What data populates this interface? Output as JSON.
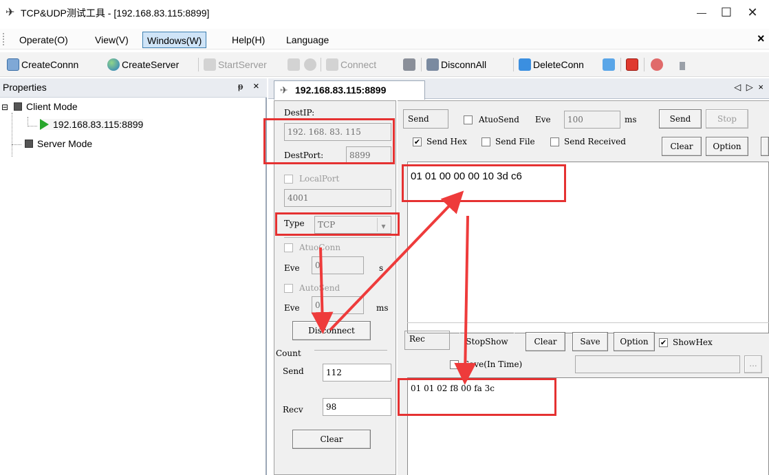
{
  "window": {
    "title": "TCP&UDP测试工具 - [192.168.83.115:8899]",
    "minimize": "—",
    "maximize": "☐",
    "close": "✕"
  },
  "menu": {
    "items": [
      "Operate(O)",
      "View(V)",
      "Windows(W)",
      "Help(H)",
      "Language"
    ],
    "close": "×"
  },
  "toolbar": {
    "create_conn": "CreateConnn",
    "create_server": "CreateServer",
    "start_server": "StartServer",
    "connect": "Connect",
    "disconn_all": "DisconnAll",
    "delete_conn": "DeleteConn"
  },
  "properties": {
    "title": "Properties",
    "pin": "ᵖ",
    "close": "×",
    "tree": {
      "client_mode": "Client Mode",
      "connection": "192.168.83.115:8899",
      "server_mode": "Server Mode"
    }
  },
  "tab": {
    "label": "192.168.83.115:8899",
    "nav": "◁ ▷ ×"
  },
  "connection": {
    "dest_ip_label": "DestIP:",
    "dest_ip": "192. 168. 83. 115",
    "dest_port_label": "DestPort:",
    "dest_port": "8899",
    "local_port_label": "LocalPort",
    "local_port": "4001",
    "type_label": "Type",
    "type_value": "TCP",
    "atuo_conn_label": "AtuoConn",
    "eve_label": "Eve",
    "eve_conn_value": "0",
    "s_unit": "s",
    "auto_send_label": "AutoSend",
    "eve_send_value": "0",
    "ms_unit": "ms",
    "disconnect_label": "Disconnect"
  },
  "count": {
    "title": "Count",
    "send_label": "Send",
    "send_value": "112",
    "recv_label": "Recv",
    "recv_value": "98",
    "clear_label": "Clear"
  },
  "send_area": {
    "send_box": "Send",
    "atuo_send_label": "AtuoSend",
    "eve_label": "Eve",
    "eve_value": "100",
    "ms_unit": "ms",
    "send_button": "Send",
    "stop_button": "Stop",
    "send_hex_label": "Send Hex",
    "send_file_label": "Send File",
    "send_received_label": "Send Received",
    "clear_button": "Clear",
    "option_button": "Option",
    "content": "01 01 00 00 00 10 3d c6"
  },
  "recv_area": {
    "rec_box": "Rec",
    "stop_show_button": "StopShow",
    "clear_button": "Clear",
    "save_button": "Save",
    "option_button": "Option",
    "show_hex_label": "ShowHex",
    "save_in_time_label": "Save(In Time)",
    "browse_button": "...",
    "content": "01 01 02 f8 00 fa 3c"
  },
  "colors": {
    "highlight": "#e53131",
    "connection_active": "#27a52b"
  }
}
